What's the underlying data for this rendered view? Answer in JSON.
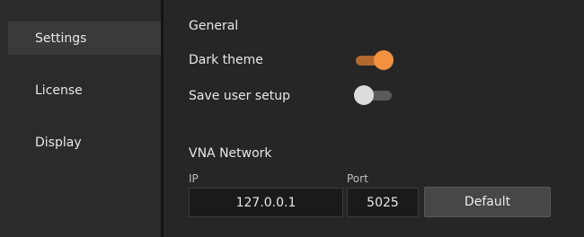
{
  "sidebar": {
    "items": [
      {
        "label": "Settings",
        "active": true
      },
      {
        "label": "License",
        "active": false
      },
      {
        "label": "Display",
        "active": false
      }
    ]
  },
  "general": {
    "title": "General",
    "dark_theme": {
      "label": "Dark theme",
      "enabled": true
    },
    "save_user_setup": {
      "label": "Save user setup",
      "enabled": false
    }
  },
  "network": {
    "title": "VNA Network",
    "ip": {
      "label": "IP",
      "value": "127.0.0.1"
    },
    "port": {
      "label": "Port",
      "value": "5025"
    },
    "default_button": "Default"
  },
  "colors": {
    "accent": "#f2913f",
    "accent_track": "#b3682e",
    "sidebar_bg": "#2b2b2b",
    "content_bg": "#262626"
  }
}
